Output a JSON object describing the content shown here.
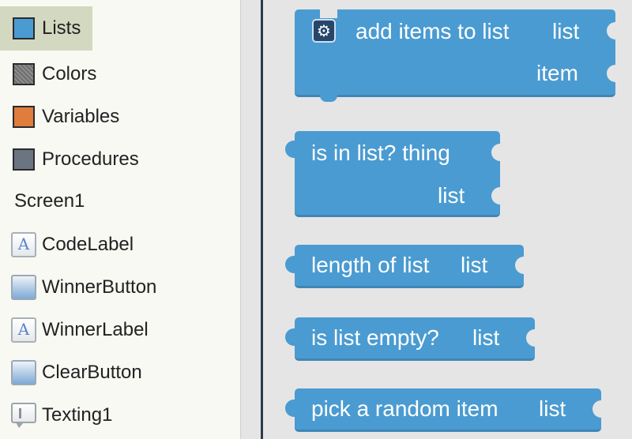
{
  "sidebar": {
    "categories": [
      {
        "label": "Lists",
        "color": "#4a9bd1",
        "selected": true,
        "icon": "lists-swatch-icon"
      },
      {
        "label": "Colors",
        "color": "#8a8a8a",
        "selected": false,
        "icon": "colors-swatch-icon"
      },
      {
        "label": "Variables",
        "color": "#e07c3c",
        "selected": false,
        "icon": "variables-swatch-icon"
      },
      {
        "label": "Procedures",
        "color": "#6a7581",
        "selected": false,
        "icon": "procedures-swatch-icon"
      }
    ],
    "screen_label": "Screen1",
    "components": [
      {
        "label": "CodeLabel",
        "icon": "label-icon"
      },
      {
        "label": "WinnerButton",
        "icon": "button-icon"
      },
      {
        "label": "WinnerLabel",
        "icon": "label-icon"
      },
      {
        "label": "ClearButton",
        "icon": "button-icon"
      },
      {
        "label": "Texting1",
        "icon": "texting-icon"
      }
    ]
  },
  "blocks": {
    "add_items": {
      "title": "add items to list",
      "socket1": "list",
      "socket2": "item"
    },
    "is_in_list": {
      "line1": "is in list? thing",
      "line2": "list"
    },
    "length_of_list": {
      "title": "length of list",
      "socket": "list"
    },
    "is_list_empty": {
      "title": "is list empty?",
      "socket": "list"
    },
    "pick_random": {
      "title": "pick a random item",
      "socket": "list"
    }
  },
  "colors": {
    "block": "#4a9bd1",
    "workspace": "#e5e5e5",
    "sidebar": "#f7f9f2",
    "selected": "#d3d8c0"
  }
}
